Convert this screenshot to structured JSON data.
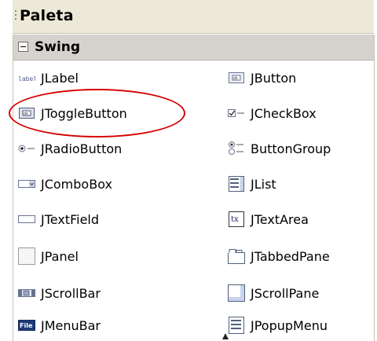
{
  "palette": {
    "title": "Paleta",
    "category": "Swing",
    "items": [
      {
        "label": "JLabel",
        "icon": "label-icon"
      },
      {
        "label": "JButton",
        "icon": "button-icon"
      },
      {
        "label": "JToggleButton",
        "icon": "toggle-button-icon"
      },
      {
        "label": "JCheckBox",
        "icon": "checkbox-icon"
      },
      {
        "label": "JRadioButton",
        "icon": "radio-button-icon"
      },
      {
        "label": "ButtonGroup",
        "icon": "button-group-icon"
      },
      {
        "label": "JComboBox",
        "icon": "combo-box-icon"
      },
      {
        "label": "JList",
        "icon": "list-icon"
      },
      {
        "label": "JTextField",
        "icon": "text-field-icon"
      },
      {
        "label": "JTextArea",
        "icon": "text-area-icon"
      },
      {
        "label": "JPanel",
        "icon": "panel-icon"
      },
      {
        "label": "JTabbedPane",
        "icon": "tabbed-pane-icon"
      },
      {
        "label": "JScrollBar",
        "icon": "scroll-bar-icon"
      },
      {
        "label": "JScrollPane",
        "icon": "scroll-pane-icon"
      },
      {
        "label": "JMenuBar",
        "icon": "menu-bar-icon"
      },
      {
        "label": "JPopupMenu",
        "icon": "popup-menu-icon"
      }
    ]
  },
  "annotation": {
    "color": "#d40000",
    "target": "JToggleButton"
  },
  "colors": {
    "header_bg": "#ece9d8",
    "category_bg": "#d6d3ce"
  }
}
